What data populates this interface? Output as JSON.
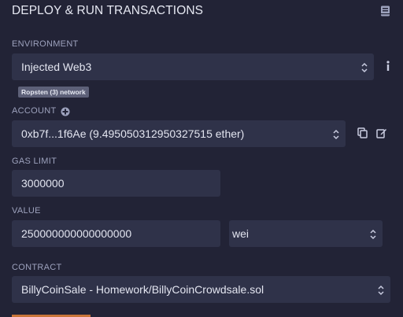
{
  "panel": {
    "title": "DEPLOY & RUN TRANSACTIONS"
  },
  "environment": {
    "label": "ENVIRONMENT",
    "value": "Injected Web3",
    "network_badge": "Ropsten (3) network"
  },
  "account": {
    "label": "ACCOUNT",
    "value": "0xb7f...1f6Ae (9.495050312950327515 ether)"
  },
  "gas_limit": {
    "label": "GAS LIMIT",
    "value": "3000000"
  },
  "value": {
    "label": "VALUE",
    "amount": "250000000000000000",
    "unit": "wei"
  },
  "contract": {
    "label": "CONTRACT",
    "value": "BillyCoinSale - Homework/BillyCoinCrowdsale.sol"
  },
  "colors": {
    "background": "#222336",
    "field": "#2f3249",
    "accent": "#c97539"
  }
}
